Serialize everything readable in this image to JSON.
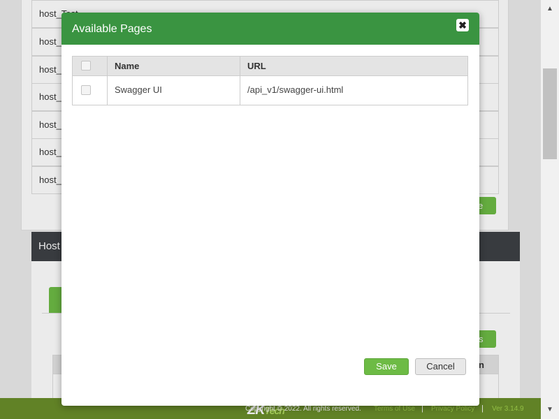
{
  "background": {
    "host_rows": [
      "host_Test",
      "host_",
      "host_",
      "host_",
      "host_",
      "host_",
      "host_"
    ],
    "card1_button_label": "e",
    "card2_title": "Host",
    "card2_button_label": "s",
    "card2_column_header": "n"
  },
  "modal": {
    "title": "Available Pages",
    "close_glyph": "✖",
    "columns": {
      "name": "Name",
      "url": "URL"
    },
    "rows": [
      {
        "name": "Swagger UI",
        "url": "/api_v1/swagger-ui.html",
        "checked": false
      }
    ],
    "save_label": "Save",
    "cancel_label": "Cancel"
  },
  "footer": {
    "copyright": "Copyright © 2022. All rights reserved.",
    "logo_main": "ZK",
    "logo_sub": "Tech",
    "terms": "Terms of Use",
    "privacy": "Privacy Policy",
    "version": "Ver 3.14.9",
    "separator": "|"
  },
  "scrollbar": {
    "up_glyph": "▲",
    "down_glyph": "▼"
  },
  "colors": {
    "header_green": "#3a9441",
    "button_green": "#6dbb45",
    "footer_green": "#6a8e2a"
  }
}
